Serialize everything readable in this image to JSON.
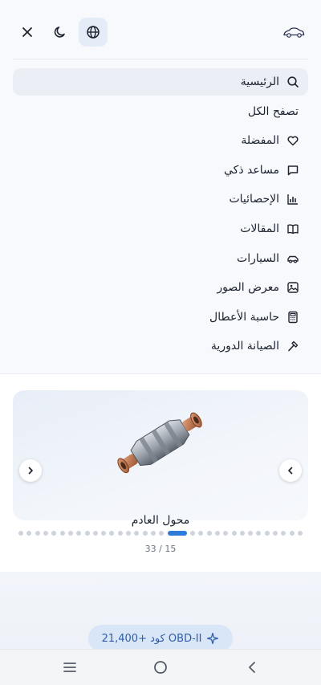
{
  "header": {
    "close_icon": "close-icon",
    "theme_icon": "moon-icon",
    "language_icon": "globe-icon",
    "logo_icon": "car-logo-icon"
  },
  "menu": {
    "items": [
      {
        "label": "الرئيسية",
        "icon": "search-icon",
        "active": true
      },
      {
        "label": "تصفح الكل",
        "icon": null,
        "active": false
      },
      {
        "label": "المفضلة",
        "icon": "heart-icon",
        "active": false
      },
      {
        "label": "مساعد ذكي",
        "icon": "chat-icon",
        "active": false
      },
      {
        "label": "الإحصائيات",
        "icon": "bar-chart-icon",
        "active": false
      },
      {
        "label": "المقالات",
        "icon": "book-icon",
        "active": false
      },
      {
        "label": "السيارات",
        "icon": "car-icon",
        "active": false
      },
      {
        "label": "معرض الصور",
        "icon": "image-icon",
        "active": false
      },
      {
        "label": "حاسبة الأعطال",
        "icon": "calculator-icon",
        "active": false
      },
      {
        "label": "الصيانة الدورية",
        "icon": "hammer-icon",
        "active": false
      }
    ]
  },
  "carousel": {
    "title": "محول العادم",
    "image": "catalytic-converter-image",
    "counter": "33 / 15",
    "current": 15,
    "total": 33,
    "accent": "#2f7bd9"
  },
  "badge": {
    "text": "OBD-II كود +21,400",
    "icon": "sparkle-icon"
  },
  "system_nav": {
    "recents_icon": "menu-lines-icon",
    "home_icon": "home-circle-icon",
    "back_icon": "back-chevron-icon"
  }
}
